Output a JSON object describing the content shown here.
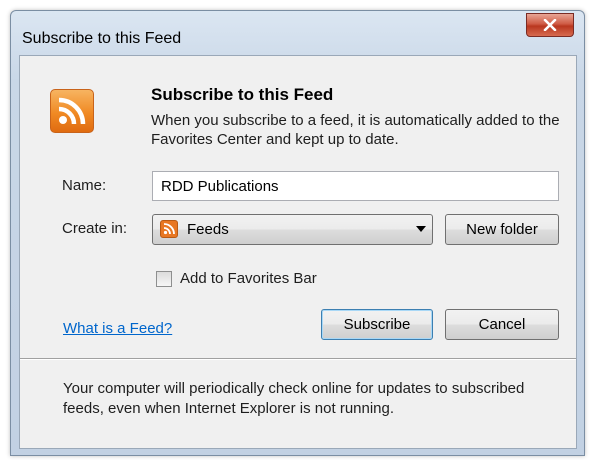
{
  "window": {
    "title": "Subscribe to this Feed"
  },
  "dialog": {
    "heading": "Subscribe to this Feed",
    "description": "When you subscribe to a feed, it is automatically added to the Favorites Center and kept up to date.",
    "name_label": "Name:",
    "name_value": "RDD Publications",
    "create_in_label": "Create in:",
    "create_in_selected": "Feeds",
    "new_folder_label": "New folder",
    "add_to_favorites_bar_label": "Add to Favorites Bar",
    "add_to_favorites_bar_checked": false,
    "what_is_feed_link": "What is a Feed?",
    "subscribe_label": "Subscribe",
    "cancel_label": "Cancel",
    "footer_text": "Your computer will periodically check online for updates to subscribed feeds, even when Internet Explorer is not running."
  },
  "icons": [
    "rss-feed-icon",
    "close-icon",
    "dropdown-arrow-icon",
    "feeds-folder-icon"
  ],
  "colors": {
    "rss_orange": "#f08a24",
    "link_blue": "#0066cc",
    "close_red": "#c94a33"
  }
}
